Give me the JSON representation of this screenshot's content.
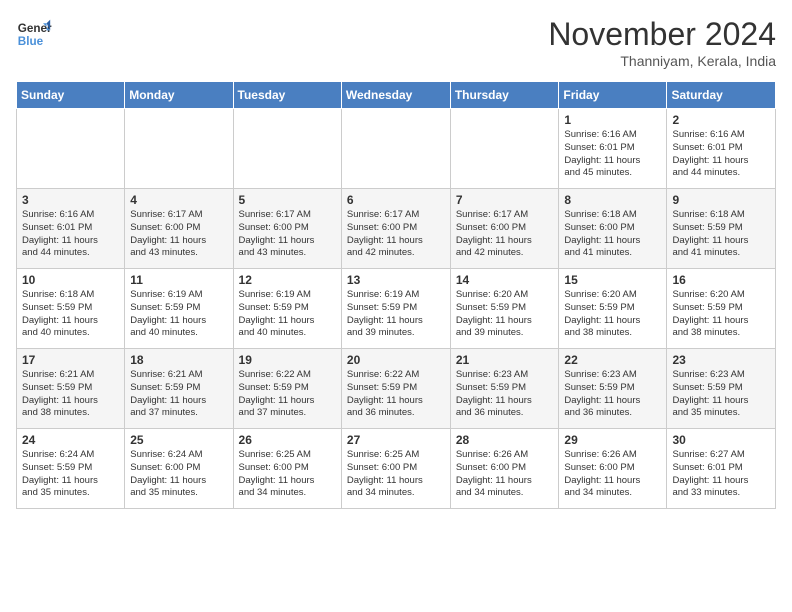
{
  "logo": {
    "line1": "General",
    "line2": "Blue"
  },
  "title": "November 2024",
  "location": "Thanniyam, Kerala, India",
  "weekdays": [
    "Sunday",
    "Monday",
    "Tuesday",
    "Wednesday",
    "Thursday",
    "Friday",
    "Saturday"
  ],
  "weeks": [
    [
      {
        "day": "",
        "info": ""
      },
      {
        "day": "",
        "info": ""
      },
      {
        "day": "",
        "info": ""
      },
      {
        "day": "",
        "info": ""
      },
      {
        "day": "",
        "info": ""
      },
      {
        "day": "1",
        "info": "Sunrise: 6:16 AM\nSunset: 6:01 PM\nDaylight: 11 hours\nand 45 minutes."
      },
      {
        "day": "2",
        "info": "Sunrise: 6:16 AM\nSunset: 6:01 PM\nDaylight: 11 hours\nand 44 minutes."
      }
    ],
    [
      {
        "day": "3",
        "info": "Sunrise: 6:16 AM\nSunset: 6:01 PM\nDaylight: 11 hours\nand 44 minutes."
      },
      {
        "day": "4",
        "info": "Sunrise: 6:17 AM\nSunset: 6:00 PM\nDaylight: 11 hours\nand 43 minutes."
      },
      {
        "day": "5",
        "info": "Sunrise: 6:17 AM\nSunset: 6:00 PM\nDaylight: 11 hours\nand 43 minutes."
      },
      {
        "day": "6",
        "info": "Sunrise: 6:17 AM\nSunset: 6:00 PM\nDaylight: 11 hours\nand 42 minutes."
      },
      {
        "day": "7",
        "info": "Sunrise: 6:17 AM\nSunset: 6:00 PM\nDaylight: 11 hours\nand 42 minutes."
      },
      {
        "day": "8",
        "info": "Sunrise: 6:18 AM\nSunset: 6:00 PM\nDaylight: 11 hours\nand 41 minutes."
      },
      {
        "day": "9",
        "info": "Sunrise: 6:18 AM\nSunset: 5:59 PM\nDaylight: 11 hours\nand 41 minutes."
      }
    ],
    [
      {
        "day": "10",
        "info": "Sunrise: 6:18 AM\nSunset: 5:59 PM\nDaylight: 11 hours\nand 40 minutes."
      },
      {
        "day": "11",
        "info": "Sunrise: 6:19 AM\nSunset: 5:59 PM\nDaylight: 11 hours\nand 40 minutes."
      },
      {
        "day": "12",
        "info": "Sunrise: 6:19 AM\nSunset: 5:59 PM\nDaylight: 11 hours\nand 40 minutes."
      },
      {
        "day": "13",
        "info": "Sunrise: 6:19 AM\nSunset: 5:59 PM\nDaylight: 11 hours\nand 39 minutes."
      },
      {
        "day": "14",
        "info": "Sunrise: 6:20 AM\nSunset: 5:59 PM\nDaylight: 11 hours\nand 39 minutes."
      },
      {
        "day": "15",
        "info": "Sunrise: 6:20 AM\nSunset: 5:59 PM\nDaylight: 11 hours\nand 38 minutes."
      },
      {
        "day": "16",
        "info": "Sunrise: 6:20 AM\nSunset: 5:59 PM\nDaylight: 11 hours\nand 38 minutes."
      }
    ],
    [
      {
        "day": "17",
        "info": "Sunrise: 6:21 AM\nSunset: 5:59 PM\nDaylight: 11 hours\nand 38 minutes."
      },
      {
        "day": "18",
        "info": "Sunrise: 6:21 AM\nSunset: 5:59 PM\nDaylight: 11 hours\nand 37 minutes."
      },
      {
        "day": "19",
        "info": "Sunrise: 6:22 AM\nSunset: 5:59 PM\nDaylight: 11 hours\nand 37 minutes."
      },
      {
        "day": "20",
        "info": "Sunrise: 6:22 AM\nSunset: 5:59 PM\nDaylight: 11 hours\nand 36 minutes."
      },
      {
        "day": "21",
        "info": "Sunrise: 6:23 AM\nSunset: 5:59 PM\nDaylight: 11 hours\nand 36 minutes."
      },
      {
        "day": "22",
        "info": "Sunrise: 6:23 AM\nSunset: 5:59 PM\nDaylight: 11 hours\nand 36 minutes."
      },
      {
        "day": "23",
        "info": "Sunrise: 6:23 AM\nSunset: 5:59 PM\nDaylight: 11 hours\nand 35 minutes."
      }
    ],
    [
      {
        "day": "24",
        "info": "Sunrise: 6:24 AM\nSunset: 5:59 PM\nDaylight: 11 hours\nand 35 minutes."
      },
      {
        "day": "25",
        "info": "Sunrise: 6:24 AM\nSunset: 6:00 PM\nDaylight: 11 hours\nand 35 minutes."
      },
      {
        "day": "26",
        "info": "Sunrise: 6:25 AM\nSunset: 6:00 PM\nDaylight: 11 hours\nand 34 minutes."
      },
      {
        "day": "27",
        "info": "Sunrise: 6:25 AM\nSunset: 6:00 PM\nDaylight: 11 hours\nand 34 minutes."
      },
      {
        "day": "28",
        "info": "Sunrise: 6:26 AM\nSunset: 6:00 PM\nDaylight: 11 hours\nand 34 minutes."
      },
      {
        "day": "29",
        "info": "Sunrise: 6:26 AM\nSunset: 6:00 PM\nDaylight: 11 hours\nand 34 minutes."
      },
      {
        "day": "30",
        "info": "Sunrise: 6:27 AM\nSunset: 6:01 PM\nDaylight: 11 hours\nand 33 minutes."
      }
    ]
  ]
}
